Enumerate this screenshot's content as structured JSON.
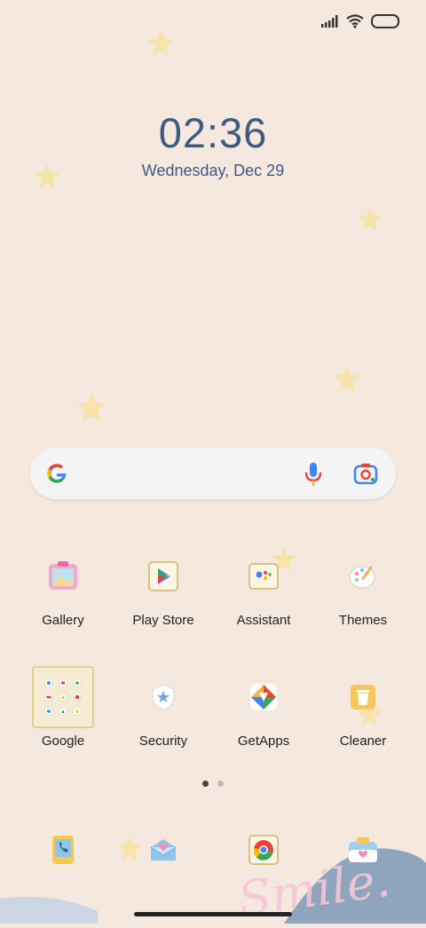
{
  "lockscreen": {
    "time": "02:36",
    "date": "Wednesday, Dec 29"
  },
  "apps_row1": [
    {
      "label": "Gallery",
      "icon": "gallery-icon"
    },
    {
      "label": "Play Store",
      "icon": "play-store-icon"
    },
    {
      "label": "Assistant",
      "icon": "assistant-icon"
    },
    {
      "label": "Themes",
      "icon": "themes-icon"
    }
  ],
  "apps_row2": [
    {
      "label": "Google",
      "icon": "google-folder-icon"
    },
    {
      "label": "Security",
      "icon": "security-icon"
    },
    {
      "label": "GetApps",
      "icon": "getapps-icon"
    },
    {
      "label": "Cleaner",
      "icon": "cleaner-icon"
    }
  ],
  "dock": [
    {
      "icon": "phone-icon"
    },
    {
      "icon": "messages-icon"
    },
    {
      "icon": "chrome-icon"
    },
    {
      "icon": "camera-icon"
    }
  ],
  "wallpaper_text": "Smile.",
  "colors": {
    "background": "#f4e8df",
    "clock": "#3e5a80",
    "star": "#f6e4a6"
  }
}
